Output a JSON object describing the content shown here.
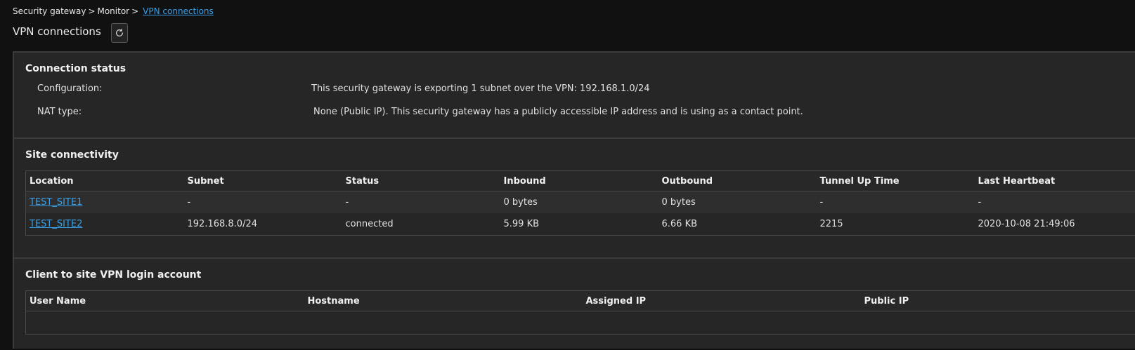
{
  "breadcrumb": {
    "items": [
      "Security gateway",
      "Monitor"
    ],
    "separator": ">",
    "current": "VPN connections"
  },
  "page": {
    "title": "VPN connections",
    "refresh_icon": "refresh-icon"
  },
  "connection_status": {
    "title": "Connection status",
    "configuration_label": "Configuration:",
    "configuration_value": "This security gateway is exporting 1 subnet over the VPN: 192.168.1.0/24",
    "nat_label": "NAT type:",
    "nat_value": "None (Public IP). This security gateway has a publicly accessible IP address and is using  as a contact point."
  },
  "site_connectivity": {
    "title": "Site connectivity",
    "columns": [
      "Location",
      "Subnet",
      "Status",
      "Inbound",
      "Outbound",
      "Tunnel Up Time",
      "Last Heartbeat"
    ],
    "rows": [
      {
        "location": "TEST_SITE1",
        "subnet": "-",
        "status": "-",
        "inbound": "0 bytes",
        "outbound": "0 bytes",
        "uptime": "-",
        "heartbeat": "-"
      },
      {
        "location": "TEST_SITE2",
        "subnet": "192.168.8.0/24",
        "status": "connected",
        "inbound": "5.99 KB",
        "outbound": "6.66 KB",
        "uptime": "2215",
        "heartbeat": "2020-10-08 21:49:06"
      }
    ]
  },
  "client_vpn": {
    "title": "Client to site VPN login account",
    "columns": [
      "User Name",
      "Hostname",
      "Assigned IP",
      "Public IP"
    ]
  },
  "colors": {
    "background": "#111111",
    "panel": "#262626",
    "link": "#3aa0e8",
    "border": "#3c3c3c"
  }
}
